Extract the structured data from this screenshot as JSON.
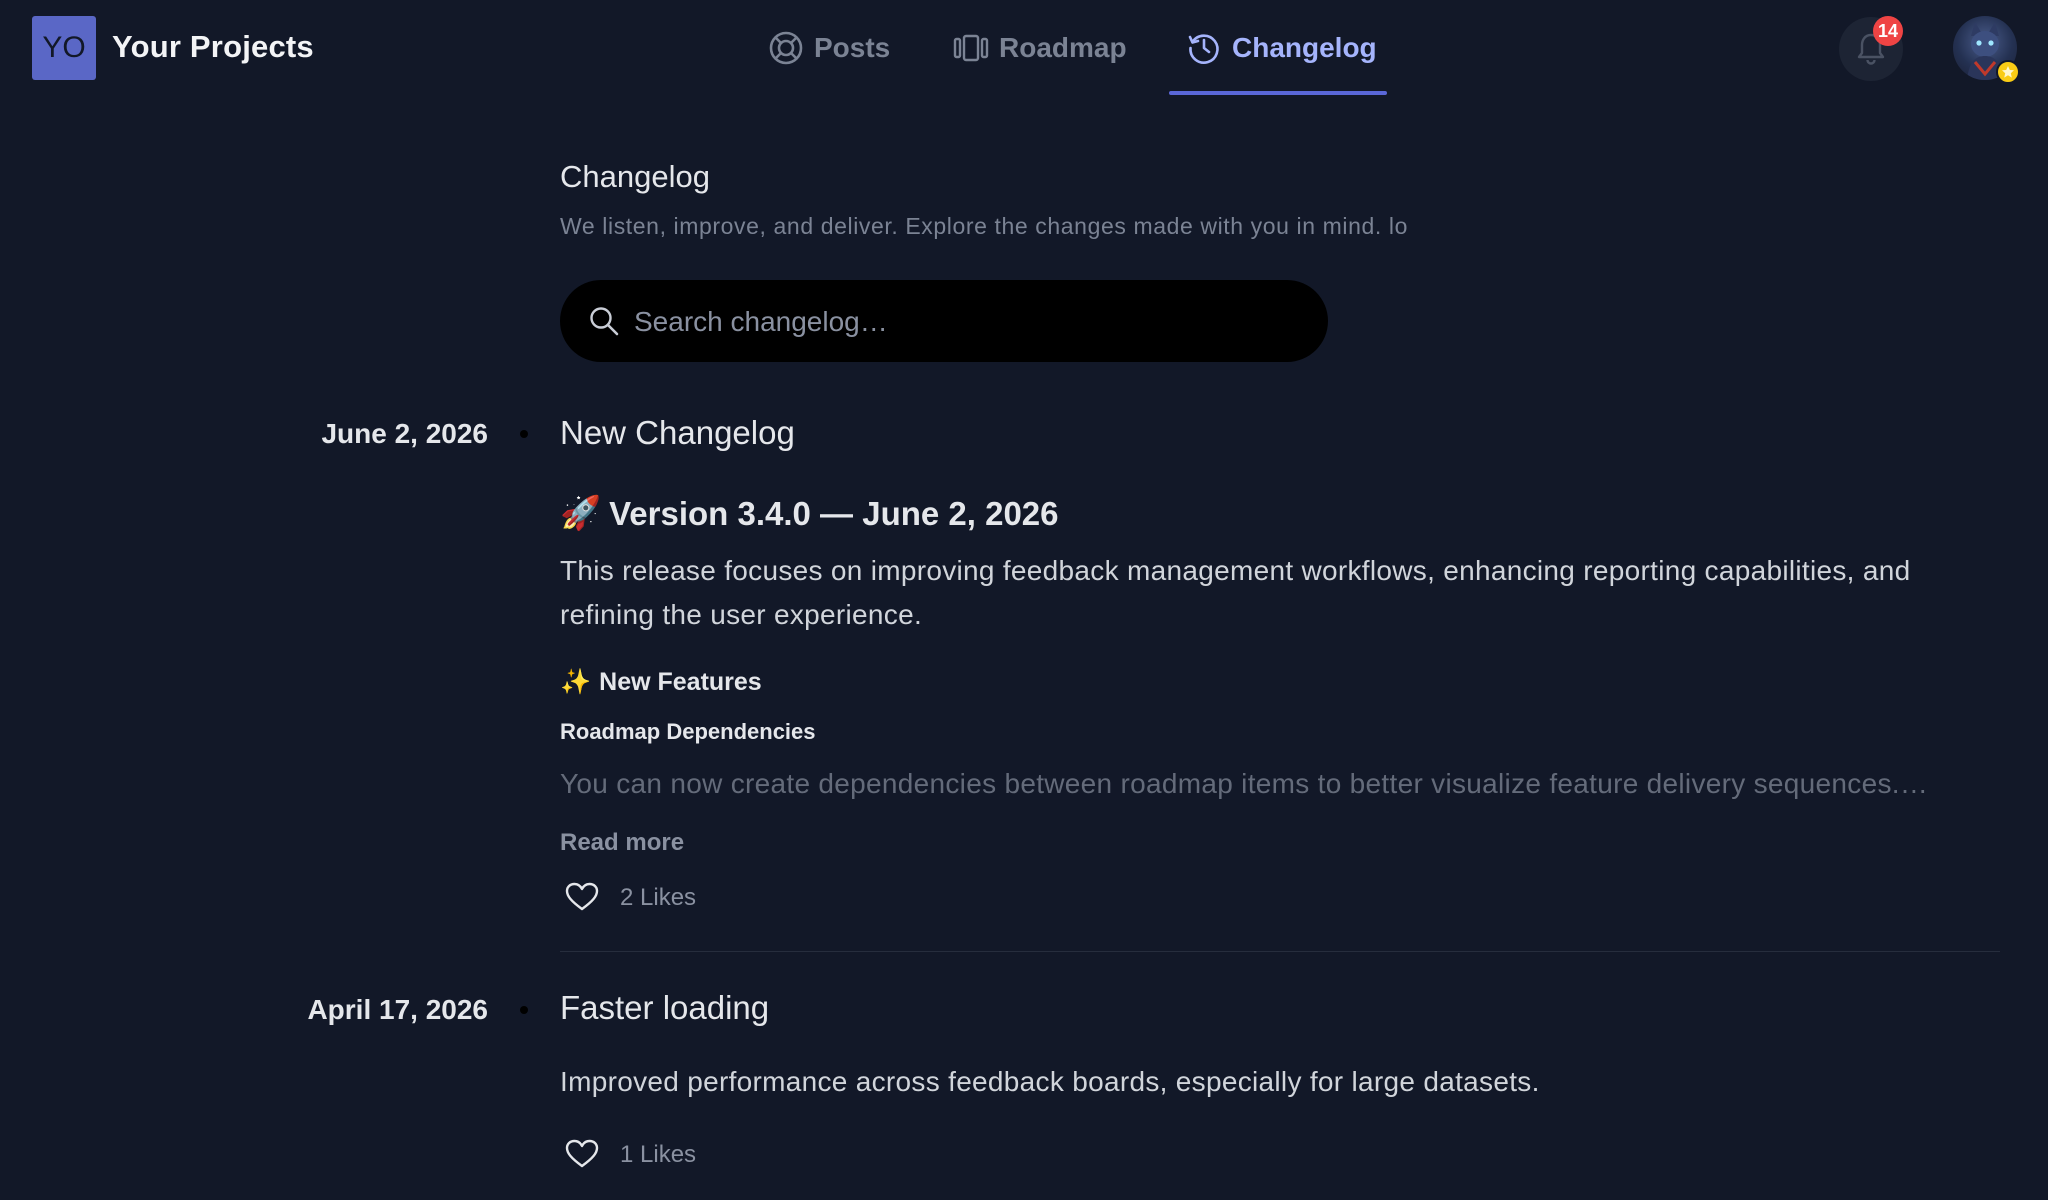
{
  "header": {
    "logo_initials": "YO",
    "brand": "Your Projects",
    "nav": {
      "posts": "Posts",
      "roadmap": "Roadmap",
      "changelog": "Changelog"
    },
    "active_tab": "Changelog",
    "notifications_count": "14",
    "icons": {
      "posts": "posts-lifebuoy-icon",
      "roadmap": "roadmap-columns-icon",
      "changelog": "history-clock-icon",
      "bell": "bell-icon",
      "star": "star-icon"
    }
  },
  "page": {
    "title": "Changelog",
    "subtitle": "We listen, improve, and deliver. Explore the changes made with you in mind. lo",
    "search_placeholder": "Search changelog…",
    "search_value": ""
  },
  "entries": [
    {
      "date": "June 2, 2026",
      "title": "New Changelog",
      "version_emoji": "🚀",
      "version_heading": "Version 3.4.0 — June 2, 2026",
      "summary": "This release focuses on improving feedback management workflows, enhancing reporting capabilities, and refining the user experience.",
      "section_emoji": "✨",
      "section_heading": "New Features",
      "feature_title": "Roadmap Dependencies",
      "feature_preview": "You can now create dependencies between roadmap items to better visualize feature delivery sequences.…",
      "read_more": "Read more",
      "likes": "2 Likes"
    },
    {
      "date": "April 17, 2026",
      "title": "Faster loading",
      "summary": "Improved performance across feedback boards, especially for large datasets.",
      "likes": "1 Likes"
    }
  ],
  "colors": {
    "background": "#121828",
    "accent": "#5a67d8",
    "active_nav": "#a5b4fc",
    "badge": "#ef4444",
    "muted_text": "#7b8394"
  }
}
